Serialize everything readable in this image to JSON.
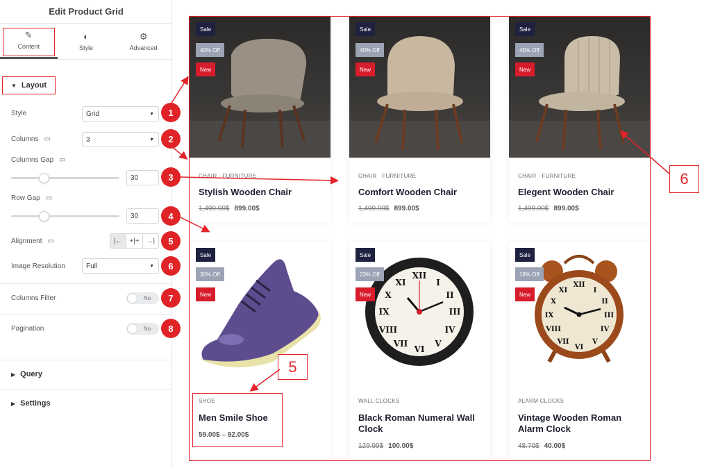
{
  "panel": {
    "title": "Edit Product Grid",
    "tabs": [
      {
        "label": "Content",
        "icon": "pencil-icon",
        "glyph": "✎"
      },
      {
        "label": "Style",
        "icon": "contrast-icon",
        "glyph": "◐"
      },
      {
        "label": "Advanced",
        "icon": "gear-icon",
        "glyph": "⚙"
      }
    ],
    "layout_section": "Layout",
    "controls": {
      "style": {
        "label": "Style",
        "value": "Grid"
      },
      "columns": {
        "label": "Columns",
        "value": "3"
      },
      "columns_gap": {
        "label": "Columns Gap",
        "value": "30"
      },
      "row_gap": {
        "label": "Row Gap",
        "value": "30"
      },
      "alignment": {
        "label": "Alignment",
        "options": [
          "|←",
          "+|+",
          "→|"
        ]
      },
      "image_resolution": {
        "label": "Image Resolution",
        "value": "Full"
      },
      "columns_filter": {
        "label": "Columns Filter",
        "value": "No"
      },
      "pagination": {
        "label": "Pagination",
        "value": "No"
      }
    },
    "sections": [
      "Query",
      "Settings"
    ],
    "badges": [
      "1",
      "2",
      "3",
      "4",
      "5",
      "6",
      "7",
      "8"
    ]
  },
  "products": [
    {
      "sale": "Sale",
      "off": "40% Off",
      "new": "New",
      "cats": [
        "CHAIR",
        "FURNITURE"
      ],
      "title": "Stylish Wooden Chair",
      "old_price": "1,499.00$",
      "price": "899.00$",
      "image": "chair-image"
    },
    {
      "sale": "Sale",
      "off": "40% Off",
      "new": "New",
      "cats": [
        "CHAIR",
        "FURNITURE"
      ],
      "title": "Comfort Wooden Chair",
      "old_price": "1,499.00$",
      "price": "899.00$",
      "image": "chair-image"
    },
    {
      "sale": "Sale",
      "off": "40% Off",
      "new": "New",
      "cats": [
        "CHAIR",
        "FURNITURE"
      ],
      "title": "Elegent Wooden Chair",
      "old_price": "1,499.00$",
      "price": "899.00$",
      "image": "chair-image"
    },
    {
      "sale": "Sale",
      "off": "30% Off",
      "new": "New",
      "cats": [
        "SHOE"
      ],
      "title": "Men Smile Shoe",
      "old_price": "",
      "price": "59.00$ – 92.00$",
      "image": "shoe-image"
    },
    {
      "sale": "Sale",
      "off": "23% Off",
      "new": "New",
      "cats": [
        "WALL CLOCKS"
      ],
      "title": "Black Roman Numeral Wall Clock",
      "old_price": "129.99$",
      "price": "100.00$",
      "image": "wall-clock-image"
    },
    {
      "sale": "Sale",
      "off": "18% Off",
      "new": "New",
      "cats": [
        "ALARM CLOCKS"
      ],
      "title": "Vintage Wooden Roman Alarm Clock",
      "old_price": "48.70$",
      "price": "40.00$",
      "image": "alarm-clock-image"
    }
  ],
  "callouts": {
    "grid": "6",
    "title": "5"
  },
  "colors": {
    "accent_red": "#e32329",
    "sale_tag": "#1f2140",
    "off_tag": "#9ba3b5",
    "new_tag": "#d71c2b"
  }
}
